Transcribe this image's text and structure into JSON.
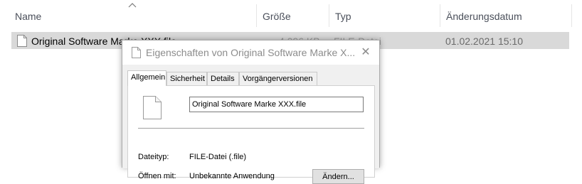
{
  "columns": {
    "name": "Name",
    "size": "Größe",
    "type": "Typ",
    "date": "Änderungsdatum"
  },
  "file": {
    "name": "Original Software Marke XXX.file",
    "size": "4.096 KB",
    "type": "FILE-Datei",
    "date": "01.02.2021 15:10"
  },
  "dialog": {
    "title": "Eigenschaften von Original Software Marke X...",
    "close_glyph": "✕",
    "tabs": [
      "Allgemein",
      "Sicherheit",
      "Details",
      "Vorgängerversionen"
    ],
    "filename_value": "Original Software Marke XXX.file",
    "filetype_label": "Dateityp:",
    "filetype_value": "FILE-Datei (.file)",
    "openwith_label": "Öffnen mit:",
    "openwith_value": "Unbekannte Anwendung",
    "change_button": "Ändern..."
  },
  "colors": {
    "selection": "#d9d9d9",
    "dialog_client": "#f0f0f0",
    "header_text": "#4a4f5a"
  }
}
